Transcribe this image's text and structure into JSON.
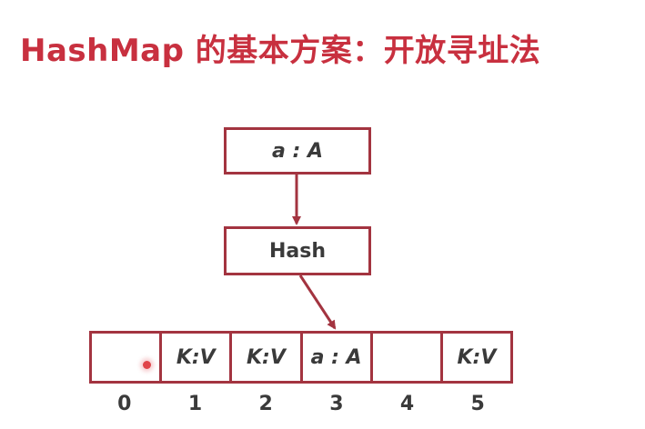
{
  "title": "HashMap 的基本方案：开放寻址法",
  "key_box": {
    "label": "a : A"
  },
  "hash_box": {
    "label": "Hash"
  },
  "array": {
    "cells": [
      "",
      "K:V",
      "K:V",
      "a : A",
      "",
      "K:V"
    ],
    "indices": [
      "0",
      "1",
      "2",
      "3",
      "4",
      "5"
    ]
  },
  "colors": {
    "title": "#c8303f",
    "border": "#a33440",
    "text": "#3a3a3a"
  }
}
